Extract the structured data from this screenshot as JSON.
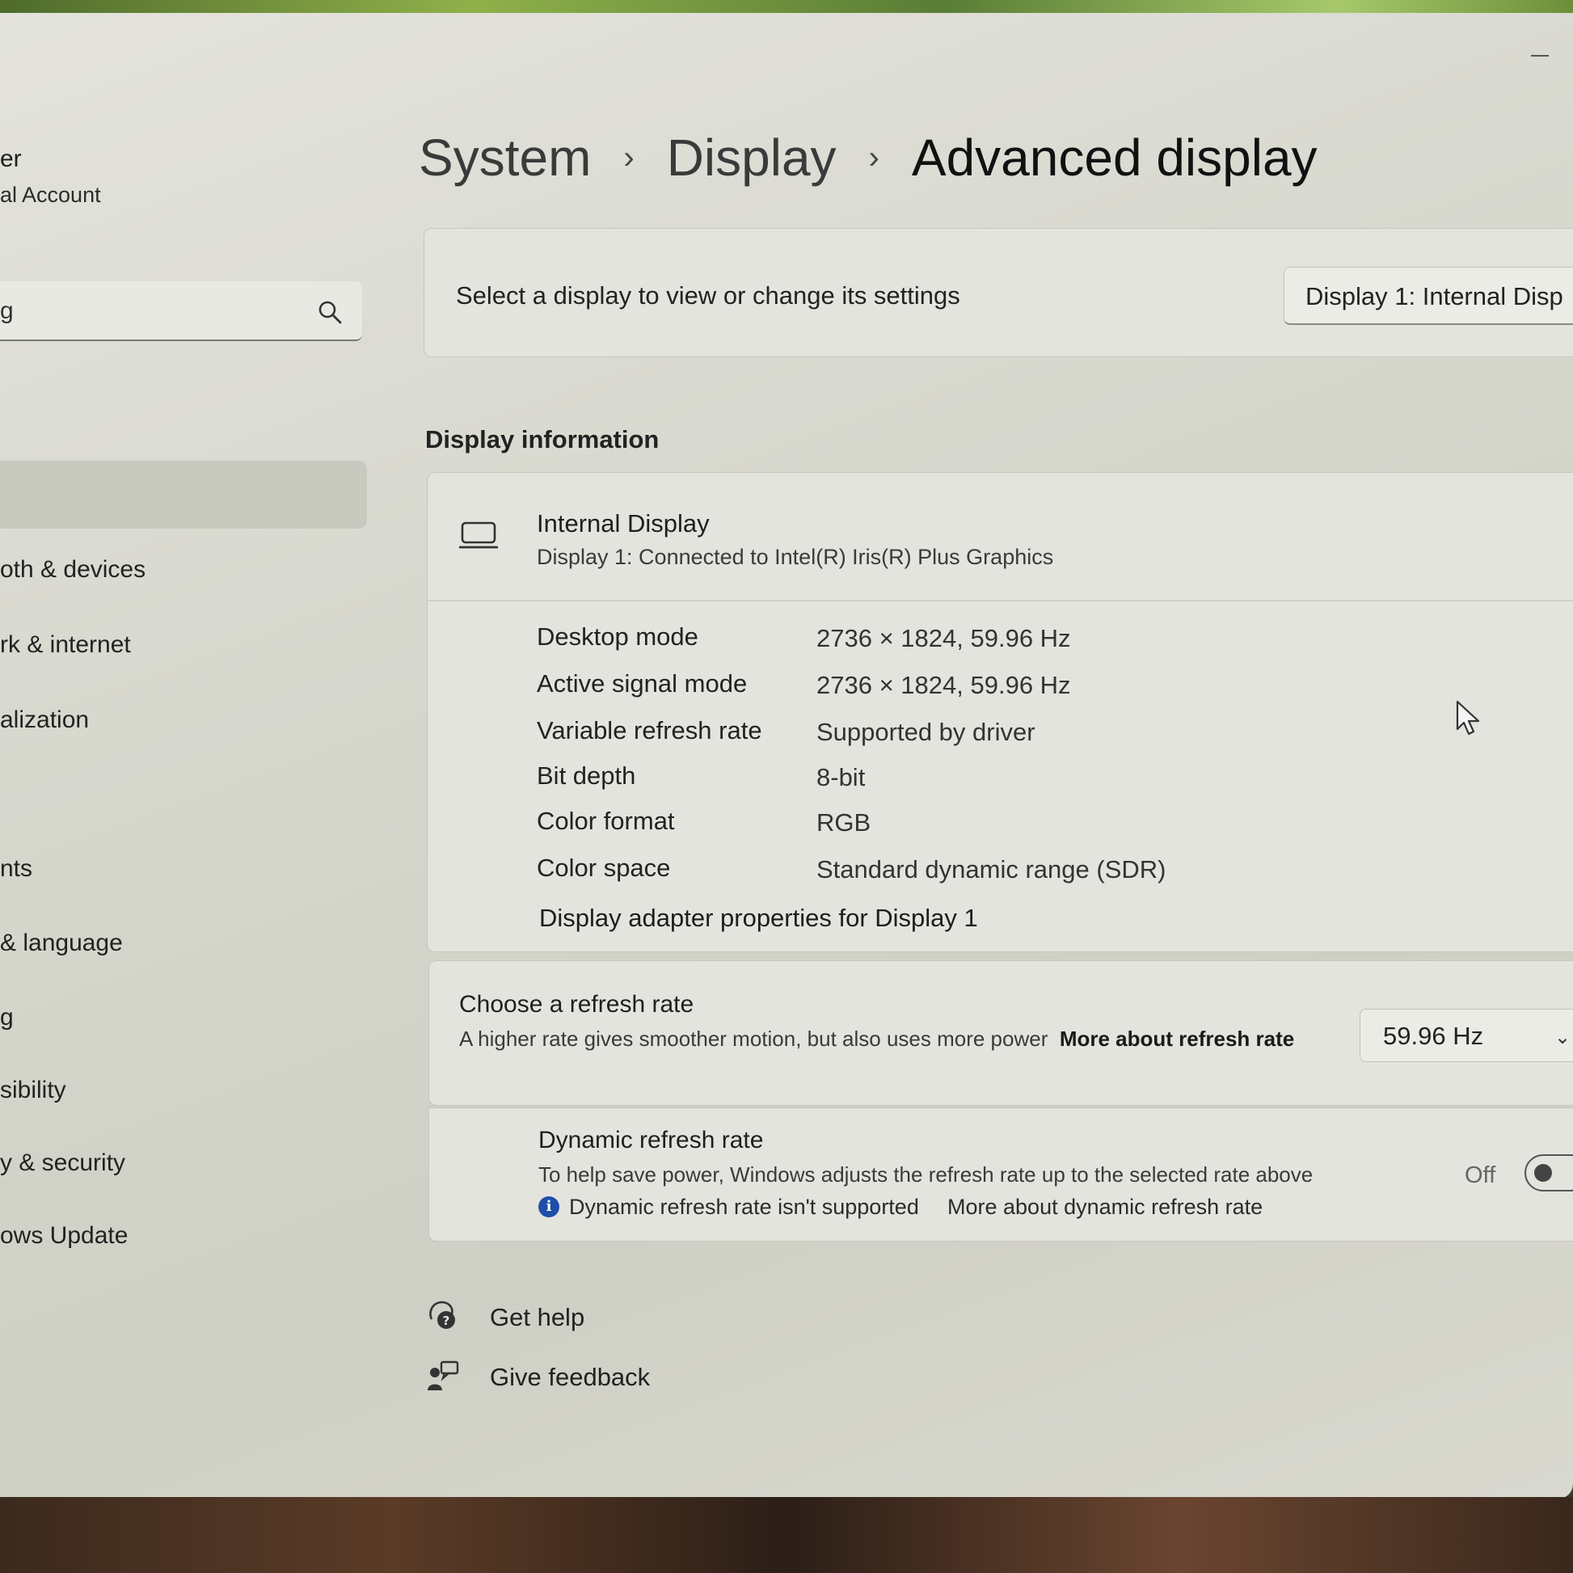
{
  "sidebar": {
    "user_name": "er",
    "user_account": "al Account",
    "search_value": "g",
    "items": [
      "oth & devices",
      "rk & internet",
      "alization",
      "nts",
      "& language",
      "g",
      "sibility",
      "y & security",
      "ows Update"
    ]
  },
  "breadcrumb": {
    "system": "System",
    "display": "Display",
    "current": "Advanced display",
    "separator": "›"
  },
  "select_display": {
    "label": "Select a display to view or change its settings",
    "dropdown_value": "Display 1: Internal Disp"
  },
  "display_info": {
    "section_title": "Display information",
    "name": "Internal Display",
    "subtitle": "Display 1: Connected to Intel(R) Iris(R) Plus Graphics",
    "properties": [
      {
        "label": "Desktop mode",
        "value": "2736 × 1824, 59.96 Hz"
      },
      {
        "label": "Active signal mode",
        "value": "2736 × 1824, 59.96 Hz"
      },
      {
        "label": "Variable refresh rate",
        "value": "Supported by driver"
      },
      {
        "label": "Bit depth",
        "value": "8-bit"
      },
      {
        "label": "Color format",
        "value": "RGB"
      },
      {
        "label": "Color space",
        "value": "Standard dynamic range (SDR)"
      }
    ],
    "adapter_link": "Display adapter properties for Display 1"
  },
  "refresh_rate": {
    "title": "Choose a refresh rate",
    "description": "A higher rate gives smoother motion, but also uses more power",
    "link": "More about refresh rate",
    "value": "59.96 Hz"
  },
  "dynamic_refresh": {
    "title": "Dynamic refresh rate",
    "description": "To help save power, Windows adjusts the refresh rate up to the selected rate above",
    "note": "Dynamic refresh rate isn't supported",
    "link": "More about dynamic refresh rate",
    "toggle_label": "Off",
    "toggle_on": false
  },
  "footer": {
    "help": "Get help",
    "feedback": "Give feedback"
  },
  "icons": {
    "search": "search-icon",
    "laptop": "laptop-icon",
    "info": "info-icon",
    "help": "help-icon",
    "feedback": "feedback-icon",
    "cursor": "mouse-cursor-icon"
  },
  "colors": {
    "info_icon": "#1f4fa8"
  }
}
